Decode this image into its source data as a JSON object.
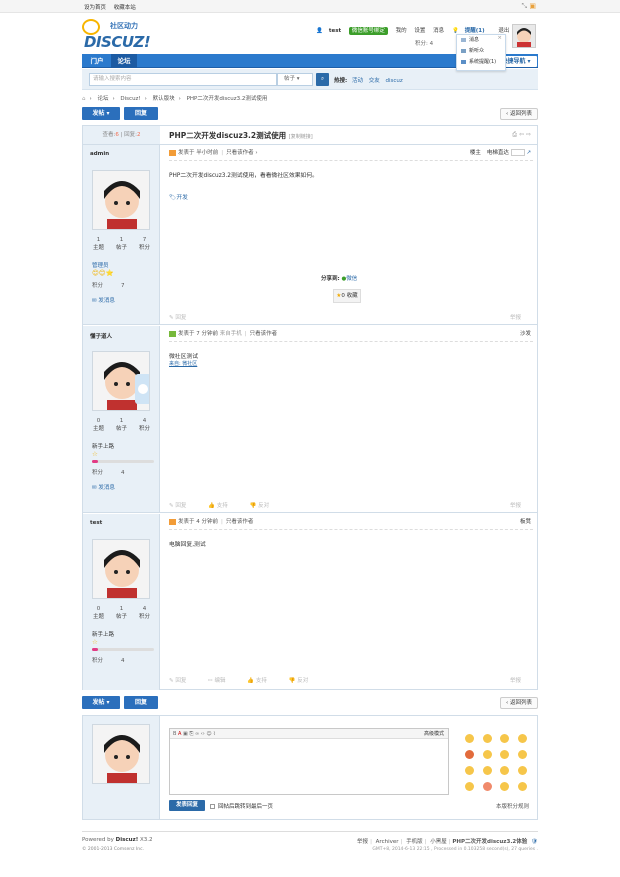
{
  "topbar": {
    "links": [
      "设为首页",
      "收藏本站"
    ]
  },
  "logo": {
    "tagline": "社区动力",
    "brand": "DISCUZ!"
  },
  "userbar": {
    "username": "test",
    "bind": "微信账号绑定",
    "my": "我的",
    "settings": "设置",
    "messages": "消息",
    "remind": "提醒(1)",
    "logout": "退出",
    "credit": "积分: 4"
  },
  "dropdown": {
    "items": [
      "消息",
      "新听众",
      "系统提醒(1)"
    ]
  },
  "nav": {
    "items": [
      "门户",
      "论坛"
    ],
    "right_btn": "快捷导航"
  },
  "search": {
    "placeholder": "请输入搜索内容",
    "scope": "帖子",
    "hot_label": "热搜:",
    "hot": [
      "活动",
      "交友",
      "discuz"
    ]
  },
  "breadcrumb": [
    "论坛",
    "Discuz!",
    "默认版块",
    "PHP二次开发discuz3.2测试使用"
  ],
  "actions": {
    "post": "发帖",
    "reply": "回复",
    "back": "返回列表"
  },
  "thread": {
    "views_label": "查看:",
    "views": "6",
    "replies_label": "回复:",
    "replies": "2",
    "title": "PHP二次开发discuz3.2测试使用",
    "copy_link": "[复制链接]"
  },
  "posts": [
    {
      "author": "admin",
      "stats": [
        {
          "v": "1",
          "l": "主题"
        },
        {
          "v": "1",
          "l": "帖子"
        },
        {
          "v": "7",
          "l": "积分"
        }
      ],
      "group": "管理员",
      "score_label": "积分",
      "score": "7",
      "msg": "发消息",
      "meta": "发表于 半小时前",
      "only_author": "只看该作者",
      "floor": "楼主",
      "extra": "电梯直达",
      "body": "PHP二次开发discuz3.2测试使用，看看微社区效果如何。",
      "tag": "开发",
      "share_label": "分享到:",
      "share_wx": "微信",
      "recommend": "0 收藏",
      "foot": [
        "回复"
      ],
      "foot_right": "举报"
    },
    {
      "author": "懂子道人",
      "stats": [
        {
          "v": "0",
          "l": "主题"
        },
        {
          "v": "1",
          "l": "帖子"
        },
        {
          "v": "4",
          "l": "积分"
        }
      ],
      "group": "新手上路",
      "score_label": "积分",
      "score": "4",
      "msg": "发消息",
      "meta": "发表于 7 分钟前",
      "device": "来自手机",
      "only_author": "只看该作者",
      "floor": "沙发",
      "body": "微社区测试",
      "source": "来自: 微社区",
      "foot": [
        "回复",
        "支持",
        "反对"
      ],
      "foot_right": "举报"
    },
    {
      "author": "test",
      "stats": [
        {
          "v": "0",
          "l": "主题"
        },
        {
          "v": "1",
          "l": "帖子"
        },
        {
          "v": "4",
          "l": "积分"
        }
      ],
      "group": "新手上路",
      "score_label": "积分",
      "score": "4",
      "meta": "发表于 4 分钟前",
      "only_author": "只看该作者",
      "floor": "板凳",
      "body": "电脑回复,测试",
      "foot": [
        "回复",
        "编辑",
        "支持",
        "反对"
      ],
      "foot_right": "举报"
    }
  ],
  "reply_box": {
    "advanced": "高级模式",
    "submit": "发表回复",
    "checkbox": "回帖后跳转到最后一页",
    "rules": "本版积分规则"
  },
  "footer": {
    "powered": "Powered by",
    "brand": "Discuz!",
    "version": "X3.2",
    "copyright": "© 2001-2013 Comsenz Inc.",
    "links": [
      "举报",
      "Archiver",
      "手机版",
      "小黑屋",
      "PHP二次开发discuz3.2体验"
    ],
    "stats": "GMT+8, 2014-6-13 22:15 , Processed in 0.103258 second(s), 27 queries ."
  },
  "colors": {
    "primary": "#2b7acd",
    "sidebar": "#e8f0f7",
    "accent": "#f26c4f"
  }
}
